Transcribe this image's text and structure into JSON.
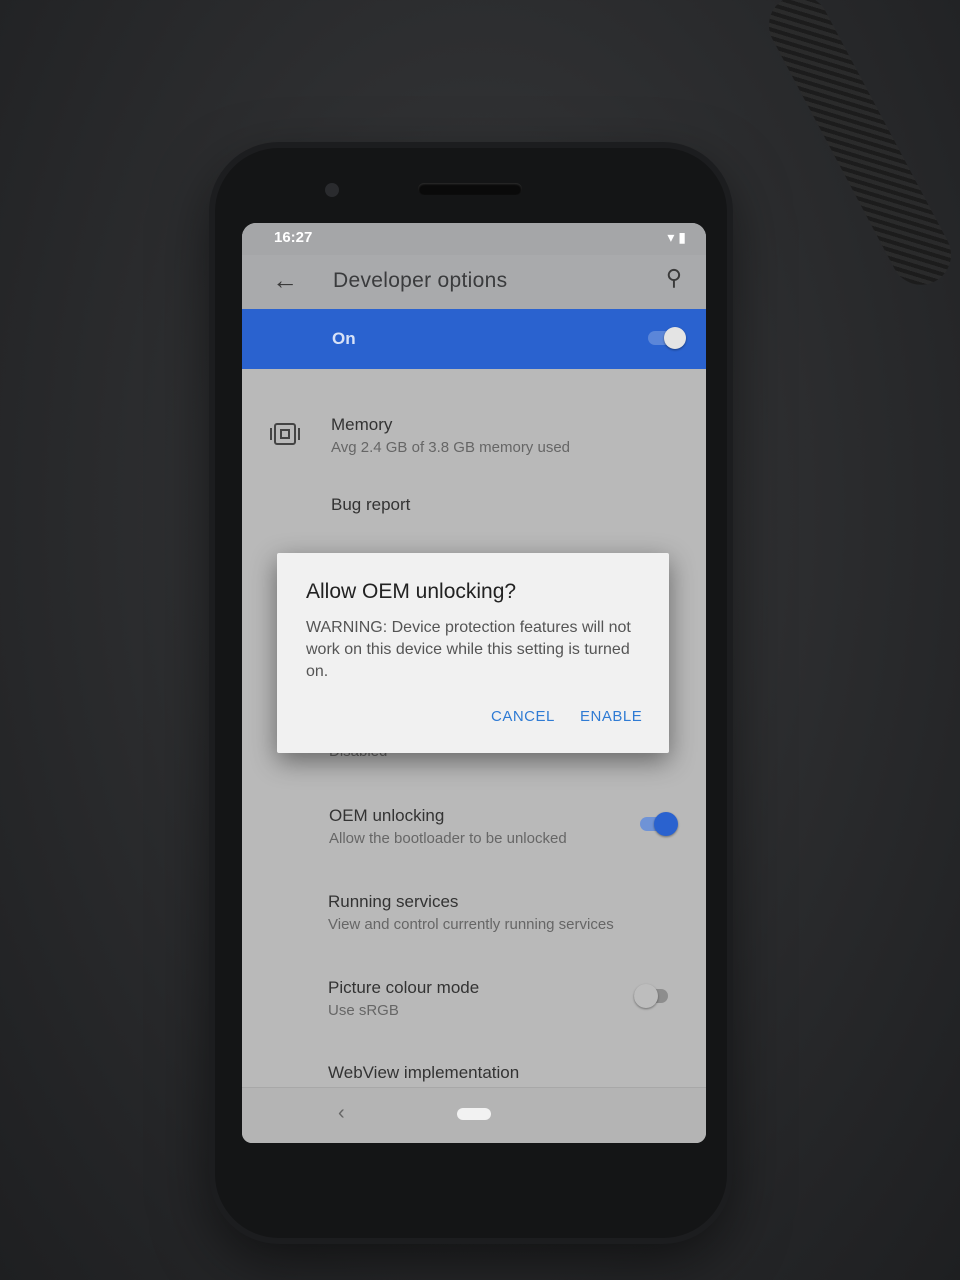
{
  "status_bar": {
    "time": "16:27",
    "icons": "▾ ▮"
  },
  "app_bar": {
    "back_glyph": "←",
    "title": "Developer options",
    "search_glyph": "⚲"
  },
  "master_switch": {
    "label": "On",
    "state": true,
    "accent": "#2a62cf"
  },
  "settings": [
    {
      "title": "Memory",
      "subtitle": "Avg 2.4 GB of 3.8 GB memory used",
      "icon": "chip-icon"
    },
    {
      "title": "Bug report"
    },
    {
      "partial_text": "Disabled"
    },
    {
      "title": "OEM unlocking",
      "subtitle": "Allow the bootloader to be unlocked",
      "toggle": true
    },
    {
      "title": "Running services",
      "subtitle": "View and control currently running services"
    },
    {
      "title": "Picture colour mode",
      "subtitle": "Use sRGB",
      "toggle": false
    },
    {
      "title": "WebView implementation"
    }
  ],
  "dialog": {
    "title": "Allow OEM unlocking?",
    "body": "WARNING: Device protection features will not work on this device while this setting is turned on.",
    "cancel_label": "CANCEL",
    "enable_label": "ENABLE",
    "button_color": "#2f7bd4"
  },
  "nav_bar": {
    "back_glyph": "‹"
  }
}
